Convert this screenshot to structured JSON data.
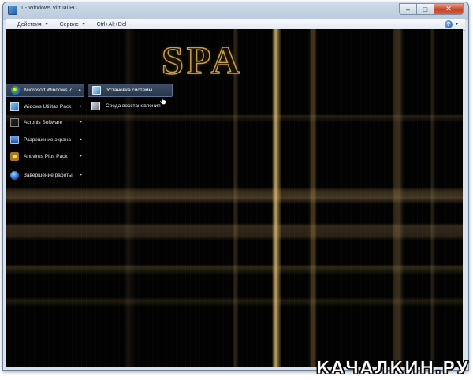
{
  "window": {
    "title": "1 - Windows Virtual PC",
    "controls": {
      "minimize": "–",
      "maximize": "□",
      "close": "✕"
    }
  },
  "toolbar": {
    "items": [
      {
        "label": "Действия"
      },
      {
        "label": "Сервис"
      },
      {
        "label": "Ctrl+Alt+Del"
      }
    ],
    "help_icon": "help-icon"
  },
  "desktop": {
    "logo_text": "SPA",
    "main_menu": [
      {
        "label": "Microsoft Windows 7",
        "icon": "windows-logo-icon",
        "active": true,
        "has_submenu": true
      },
      {
        "label": "Widows Utilitas Pack",
        "icon": "utilities-pack-icon",
        "active": false,
        "has_submenu": true
      },
      {
        "label": "Acronis Software",
        "icon": "acronis-icon",
        "active": false,
        "has_submenu": true
      },
      {
        "label": "Разрешение экрана",
        "icon": "monitor-icon",
        "active": false,
        "has_submenu": true
      },
      {
        "label": "Antivirus Plus Pack",
        "icon": "antivirus-icon",
        "active": false,
        "has_submenu": true
      },
      {
        "label": "Завершение работы",
        "icon": "shutdown-icon",
        "active": false,
        "has_submenu": true
      }
    ],
    "sub_menu": [
      {
        "label": "Установка системы",
        "icon": "install-icon",
        "active": true
      },
      {
        "label": "Среда восстановления",
        "icon": "recovery-icon",
        "active": false
      }
    ]
  },
  "watermark": "КАЧАЛКИН.РУ",
  "colors": {
    "frame": "#b9cadc",
    "desktop_bg": "#020202",
    "accent_gold": "#c89f4a",
    "menu_active": "#3e4f66",
    "close_button": "#c3452b"
  }
}
